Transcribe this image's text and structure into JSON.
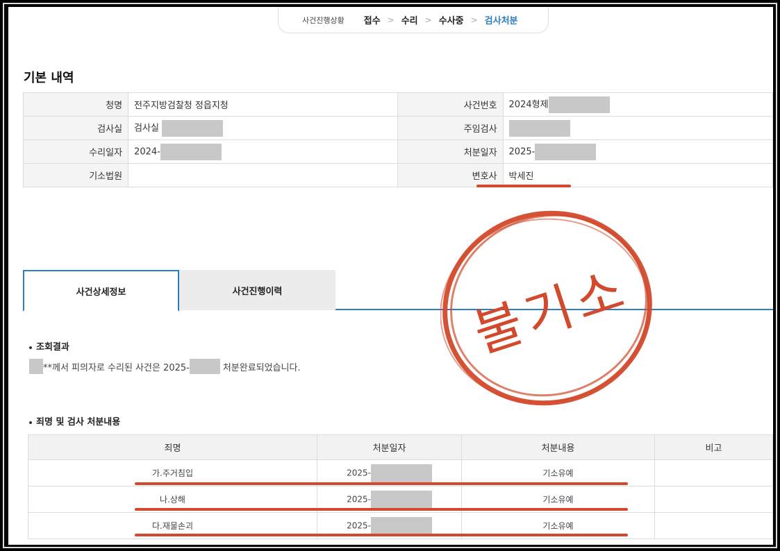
{
  "progress": {
    "label": "사건진행상황",
    "steps": [
      "접수",
      "수리",
      "수사중",
      "검사처분"
    ],
    "separator": ">"
  },
  "basic": {
    "title": "기본 내역",
    "rows": [
      {
        "k1": "청명",
        "v1": "전주지방검찰청 정읍지청",
        "k2": "사건번호",
        "v2": "2024형제"
      },
      {
        "k1": "검사실",
        "v1": "검사실",
        "k2": "주임검사",
        "v2": ""
      },
      {
        "k1": "수리일자",
        "v1": "2024-",
        "k2": "처분일자",
        "v2": "2025-"
      },
      {
        "k1": "기소법원",
        "v1": "",
        "k2": "변호사",
        "v2": "박세진"
      }
    ]
  },
  "tabs": [
    "사건상세정보",
    "사건진행이력"
  ],
  "query": {
    "title": "조회결과",
    "text_a": "**께서 피의자로 수리된 사건은 2025-",
    "text_b": "처분완료되었습니다."
  },
  "crime": {
    "title": "죄명 및 검사 처분내용",
    "headers": [
      "죄명",
      "처분일자",
      "처분내용",
      "비고"
    ],
    "rows": [
      {
        "name": "가.주거침입",
        "date": "2025-",
        "result": "기소유예",
        "note": ""
      },
      {
        "name": "나.상해",
        "date": "2025-",
        "result": "기소유예",
        "note": ""
      },
      {
        "name": "다.재물손괴",
        "date": "2025-",
        "result": "기소유예",
        "note": ""
      }
    ]
  },
  "stamp": {
    "text": "불기소",
    "color": "#d24a2b"
  },
  "colors": {
    "accent": "#2b7dbf",
    "markup": "#d24a2b"
  }
}
